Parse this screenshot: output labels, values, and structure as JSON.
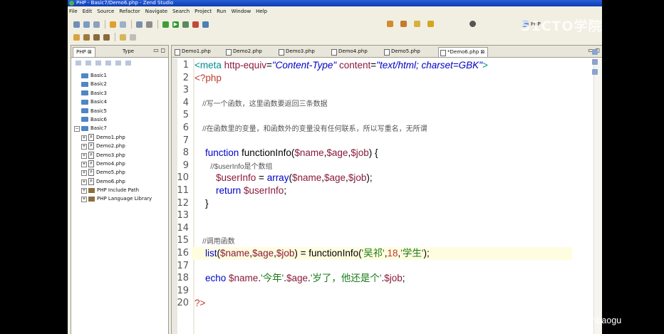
{
  "window": {
    "title": "PHP - Basic7/Demo6.php - Zend Studio"
  },
  "menu": [
    "File",
    "Edit",
    "Source",
    "Refactor",
    "Navigate",
    "Search",
    "Project",
    "Run",
    "Window",
    "Help"
  ],
  "perspective": {
    "label": "PHP"
  },
  "watermark": "51CTO学院",
  "explorer": {
    "tabs": [
      {
        "label": "PHP"
      },
      {
        "label": "Type"
      }
    ],
    "items": [
      {
        "label": "Basic1",
        "kind": "folder",
        "depth": 1
      },
      {
        "label": "Basic2",
        "kind": "folder",
        "depth": 1
      },
      {
        "label": "Basic3",
        "kind": "folder",
        "depth": 1
      },
      {
        "label": "Basic4",
        "kind": "folder",
        "depth": 1
      },
      {
        "label": "Basic5",
        "kind": "folder",
        "depth": 1
      },
      {
        "label": "Basic6",
        "kind": "folder",
        "depth": 1
      },
      {
        "label": "Basic7",
        "kind": "folder-open",
        "depth": 1
      },
      {
        "label": "Demo1.php",
        "kind": "php",
        "depth": 2
      },
      {
        "label": "Demo2.php",
        "kind": "php",
        "depth": 2
      },
      {
        "label": "Demo3.php",
        "kind": "php",
        "depth": 2
      },
      {
        "label": "Demo4.php",
        "kind": "php",
        "depth": 2
      },
      {
        "label": "Demo5.php",
        "kind": "php",
        "depth": 2
      },
      {
        "label": "Demo6.php",
        "kind": "php",
        "depth": 2
      },
      {
        "label": "PHP Include Path",
        "kind": "lib",
        "depth": 2
      },
      {
        "label": "PHP Language Library",
        "kind": "lib",
        "depth": 2
      }
    ]
  },
  "editor": {
    "tabs": [
      {
        "label": "Demo1.php"
      },
      {
        "label": "Demo2.php"
      },
      {
        "label": "Demo3.php"
      },
      {
        "label": "Demo4.php"
      },
      {
        "label": "Demo5.php"
      },
      {
        "label": "*Demo6.php",
        "active": true
      }
    ],
    "current_line": 16,
    "lines": [
      {
        "n": "1",
        "parts": [
          [
            "tag",
            "<meta "
          ],
          [
            "var",
            "http-equiv"
          ],
          [
            "fn",
            "="
          ],
          [
            "kw ital",
            "\"Content-Type\""
          ],
          [
            "fn",
            " "
          ],
          [
            "var",
            "content"
          ],
          [
            "fn",
            "="
          ],
          [
            "kw ital",
            "\"text/html; charset=GBK\""
          ],
          [
            "tag",
            ">"
          ]
        ]
      },
      {
        "n": "2",
        "parts": [
          [
            "php",
            "<?php"
          ]
        ]
      },
      {
        "n": "3",
        "parts": []
      },
      {
        "n": "4",
        "parts": [
          [
            "cm",
            "    //写一个函数，这里函数要返回三条数据"
          ]
        ]
      },
      {
        "n": "5",
        "parts": []
      },
      {
        "n": "6",
        "parts": [
          [
            "cm",
            "    //在函数里的变量，和函数外的变量没有任何联系，所以写重名，无所谓"
          ]
        ]
      },
      {
        "n": "7",
        "parts": []
      },
      {
        "n": "8",
        "parts": [
          [
            "kw",
            "    function "
          ],
          [
            "fn",
            "functionInfo("
          ],
          [
            "var",
            "$name"
          ],
          [
            "fn",
            ","
          ],
          [
            "var",
            "$age"
          ],
          [
            "fn",
            ","
          ],
          [
            "var",
            "$job"
          ],
          [
            "fn",
            ") {"
          ]
        ]
      },
      {
        "n": "9",
        "parts": [
          [
            "cm",
            "        //$userInfo是个数组"
          ]
        ]
      },
      {
        "n": "10",
        "parts": [
          [
            "var",
            "        $userInfo"
          ],
          [
            "fn",
            " = "
          ],
          [
            "kw",
            "array"
          ],
          [
            "fn",
            "("
          ],
          [
            "var",
            "$name"
          ],
          [
            "fn",
            ","
          ],
          [
            "var",
            "$age"
          ],
          [
            "fn",
            ","
          ],
          [
            "var",
            "$job"
          ],
          [
            "fn",
            ");"
          ]
        ]
      },
      {
        "n": "11",
        "parts": [
          [
            "kw",
            "        return "
          ],
          [
            "var",
            "$userInfo"
          ],
          [
            "fn",
            ";"
          ]
        ]
      },
      {
        "n": "12",
        "parts": [
          [
            "fn",
            "    }"
          ]
        ]
      },
      {
        "n": "13",
        "parts": []
      },
      {
        "n": "14",
        "parts": []
      },
      {
        "n": "15",
        "parts": [
          [
            "cm",
            "    //调用函数"
          ]
        ]
      },
      {
        "n": "16",
        "parts": [
          [
            "kw",
            "    list"
          ],
          [
            "fn",
            "("
          ],
          [
            "var",
            "$name"
          ],
          [
            "fn",
            ","
          ],
          [
            "var",
            "$age"
          ],
          [
            "fn",
            ","
          ],
          [
            "var",
            "$job"
          ],
          [
            "fn",
            ") = functionInfo("
          ],
          [
            "str",
            "'吴祁'"
          ],
          [
            "fn",
            ","
          ],
          [
            "num",
            "18"
          ],
          [
            "fn",
            ","
          ],
          [
            "str",
            "'学生'"
          ],
          [
            "fn",
            ");"
          ]
        ]
      },
      {
        "n": "17",
        "parts": []
      },
      {
        "n": "18",
        "parts": [
          [
            "kw",
            "    echo "
          ],
          [
            "var",
            "$name"
          ],
          [
            "fn",
            "."
          ],
          [
            "str",
            "'今年'"
          ],
          [
            "fn",
            "."
          ],
          [
            "var",
            "$age"
          ],
          [
            "fn",
            "."
          ],
          [
            "str",
            "'岁了，他还是个'"
          ],
          [
            "fn",
            "."
          ],
          [
            "var",
            "$job"
          ],
          [
            "fn",
            ";"
          ]
        ]
      },
      {
        "n": "19",
        "parts": []
      },
      {
        "n": "20",
        "parts": [
          [
            "php",
            "?>"
          ]
        ]
      }
    ]
  },
  "source_url": "https://blog.csdn.net/maixinbaogu"
}
